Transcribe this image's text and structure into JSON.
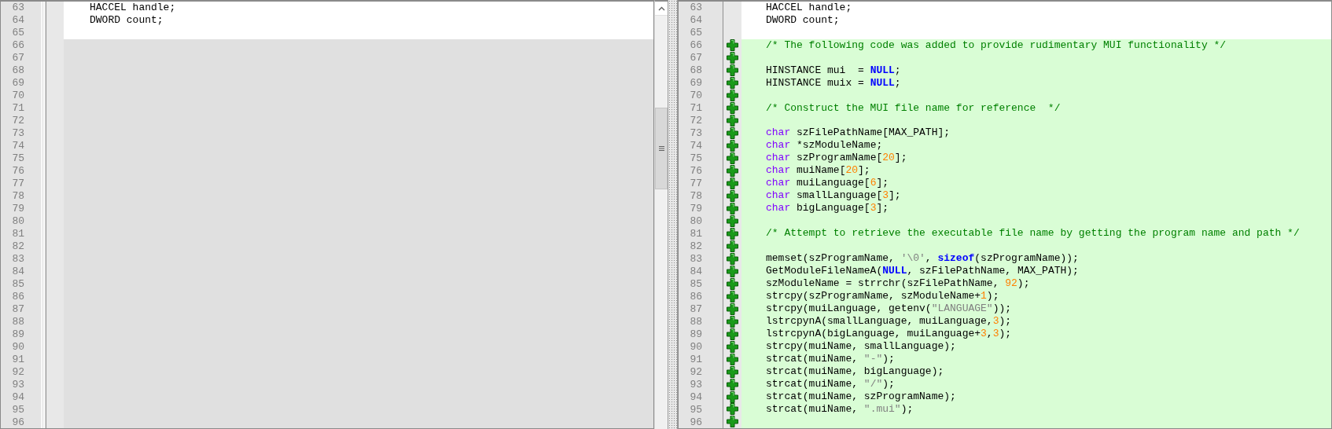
{
  "left_pane": {
    "lines": [
      {
        "number": "63",
        "kind": "normal",
        "tokens": [
          {
            "text": "HACCEL handle;",
            "kind": "plain"
          }
        ]
      },
      {
        "number": "64",
        "kind": "normal",
        "tokens": [
          {
            "text": "DWORD count;",
            "kind": "plain"
          }
        ]
      },
      {
        "number": "65",
        "kind": "normal"
      },
      {
        "number": "66",
        "kind": "placeholder"
      },
      {
        "number": "67",
        "kind": "placeholder"
      },
      {
        "number": "68",
        "kind": "placeholder"
      },
      {
        "number": "69",
        "kind": "placeholder"
      },
      {
        "number": "70",
        "kind": "placeholder"
      },
      {
        "number": "71",
        "kind": "placeholder"
      },
      {
        "number": "72",
        "kind": "placeholder"
      },
      {
        "number": "73",
        "kind": "placeholder"
      },
      {
        "number": "74",
        "kind": "placeholder"
      },
      {
        "number": "75",
        "kind": "placeholder"
      },
      {
        "number": "76",
        "kind": "placeholder"
      },
      {
        "number": "77",
        "kind": "placeholder"
      },
      {
        "number": "78",
        "kind": "placeholder"
      },
      {
        "number": "79",
        "kind": "placeholder"
      },
      {
        "number": "80",
        "kind": "placeholder"
      },
      {
        "number": "81",
        "kind": "placeholder"
      },
      {
        "number": "82",
        "kind": "placeholder"
      },
      {
        "number": "83",
        "kind": "placeholder"
      },
      {
        "number": "84",
        "kind": "placeholder"
      },
      {
        "number": "85",
        "kind": "placeholder"
      },
      {
        "number": "86",
        "kind": "placeholder"
      },
      {
        "number": "87",
        "kind": "placeholder"
      },
      {
        "number": "88",
        "kind": "placeholder"
      },
      {
        "number": "89",
        "kind": "placeholder"
      },
      {
        "number": "90",
        "kind": "placeholder"
      },
      {
        "number": "91",
        "kind": "placeholder"
      },
      {
        "number": "92",
        "kind": "placeholder"
      },
      {
        "number": "93",
        "kind": "placeholder"
      },
      {
        "number": "94",
        "kind": "placeholder"
      },
      {
        "number": "95",
        "kind": "placeholder"
      },
      {
        "number": "96",
        "kind": "placeholder"
      }
    ]
  },
  "right_pane": {
    "lines": [
      {
        "number": "63",
        "kind": "normal",
        "tokens": [
          {
            "text": "HACCEL handle;",
            "kind": "plain"
          }
        ]
      },
      {
        "number": "64",
        "kind": "normal",
        "tokens": [
          {
            "text": "DWORD count;",
            "kind": "plain"
          }
        ]
      },
      {
        "number": "65",
        "kind": "normal"
      },
      {
        "number": "66",
        "kind": "added",
        "tokens": [
          {
            "text": "/* The following code was added to provide rudimentary MUI functionality */",
            "kind": "comment"
          }
        ]
      },
      {
        "number": "67",
        "kind": "added"
      },
      {
        "number": "68",
        "kind": "added",
        "tokens": [
          {
            "text": "HINSTANCE mui  = ",
            "kind": "plain"
          },
          {
            "text": "NULL",
            "kind": "keyword"
          },
          {
            "text": ";",
            "kind": "plain"
          }
        ]
      },
      {
        "number": "69",
        "kind": "added",
        "tokens": [
          {
            "text": "HINSTANCE muix = ",
            "kind": "plain"
          },
          {
            "text": "NULL",
            "kind": "keyword"
          },
          {
            "text": ";",
            "kind": "plain"
          }
        ]
      },
      {
        "number": "70",
        "kind": "added"
      },
      {
        "number": "71",
        "kind": "added",
        "tokens": [
          {
            "text": "/* Construct the MUI file name for reference  */",
            "kind": "comment"
          }
        ]
      },
      {
        "number": "72",
        "kind": "added"
      },
      {
        "number": "73",
        "kind": "added",
        "tokens": [
          {
            "text": "char",
            "kind": "type"
          },
          {
            "text": " szFilePathName[MAX_PATH];",
            "kind": "plain"
          }
        ]
      },
      {
        "number": "74",
        "kind": "added",
        "tokens": [
          {
            "text": "char",
            "kind": "type"
          },
          {
            "text": " *szModuleName;",
            "kind": "plain"
          }
        ]
      },
      {
        "number": "75",
        "kind": "added",
        "tokens": [
          {
            "text": "char",
            "kind": "type"
          },
          {
            "text": " szProgramName[",
            "kind": "plain"
          },
          {
            "text": "20",
            "kind": "number"
          },
          {
            "text": "];",
            "kind": "plain"
          }
        ]
      },
      {
        "number": "76",
        "kind": "added",
        "tokens": [
          {
            "text": "char",
            "kind": "type"
          },
          {
            "text": " muiName[",
            "kind": "plain"
          },
          {
            "text": "20",
            "kind": "number"
          },
          {
            "text": "];",
            "kind": "plain"
          }
        ]
      },
      {
        "number": "77",
        "kind": "added",
        "tokens": [
          {
            "text": "char",
            "kind": "type"
          },
          {
            "text": " muiLanguage[",
            "kind": "plain"
          },
          {
            "text": "6",
            "kind": "number"
          },
          {
            "text": "];",
            "kind": "plain"
          }
        ]
      },
      {
        "number": "78",
        "kind": "added",
        "tokens": [
          {
            "text": "char",
            "kind": "type"
          },
          {
            "text": " smallLanguage[",
            "kind": "plain"
          },
          {
            "text": "3",
            "kind": "number"
          },
          {
            "text": "];",
            "kind": "plain"
          }
        ]
      },
      {
        "number": "79",
        "kind": "added",
        "tokens": [
          {
            "text": "char",
            "kind": "type"
          },
          {
            "text": " bigLanguage[",
            "kind": "plain"
          },
          {
            "text": "3",
            "kind": "number"
          },
          {
            "text": "];",
            "kind": "plain"
          }
        ]
      },
      {
        "number": "80",
        "kind": "added"
      },
      {
        "number": "81",
        "kind": "added",
        "tokens": [
          {
            "text": "/* Attempt to retrieve the executable file name by getting the program name and path */",
            "kind": "comment"
          }
        ]
      },
      {
        "number": "82",
        "kind": "added"
      },
      {
        "number": "83",
        "kind": "added",
        "tokens": [
          {
            "text": "memset(szProgramName, ",
            "kind": "plain"
          },
          {
            "text": "'\\0'",
            "kind": "string"
          },
          {
            "text": ", ",
            "kind": "plain"
          },
          {
            "text": "sizeof",
            "kind": "keyword"
          },
          {
            "text": "(szProgramName));",
            "kind": "plain"
          }
        ]
      },
      {
        "number": "84",
        "kind": "added",
        "tokens": [
          {
            "text": "GetModuleFileNameA(",
            "kind": "plain"
          },
          {
            "text": "NULL",
            "kind": "keyword"
          },
          {
            "text": ", szFilePathName, MAX_PATH);",
            "kind": "plain"
          }
        ]
      },
      {
        "number": "85",
        "kind": "added",
        "tokens": [
          {
            "text": "szModuleName = strrchr(szFilePathName, ",
            "kind": "plain"
          },
          {
            "text": "92",
            "kind": "number"
          },
          {
            "text": ");",
            "kind": "plain"
          }
        ]
      },
      {
        "number": "86",
        "kind": "added",
        "tokens": [
          {
            "text": "strcpy(szProgramName, szModuleName+",
            "kind": "plain"
          },
          {
            "text": "1",
            "kind": "number"
          },
          {
            "text": ");",
            "kind": "plain"
          }
        ]
      },
      {
        "number": "87",
        "kind": "added",
        "tokens": [
          {
            "text": "strcpy(muiLanguage, getenv(",
            "kind": "plain"
          },
          {
            "text": "\"LANGUAGE\"",
            "kind": "string"
          },
          {
            "text": "));",
            "kind": "plain"
          }
        ]
      },
      {
        "number": "88",
        "kind": "added",
        "tokens": [
          {
            "text": "lstrcpynA(smallLanguage, muiLanguage,",
            "kind": "plain"
          },
          {
            "text": "3",
            "kind": "number"
          },
          {
            "text": ");",
            "kind": "plain"
          }
        ]
      },
      {
        "number": "89",
        "kind": "added",
        "tokens": [
          {
            "text": "lstrcpynA(bigLanguage, muiLanguage+",
            "kind": "plain"
          },
          {
            "text": "3",
            "kind": "number"
          },
          {
            "text": ",",
            "kind": "plain"
          },
          {
            "text": "3",
            "kind": "number"
          },
          {
            "text": ");",
            "kind": "plain"
          }
        ]
      },
      {
        "number": "90",
        "kind": "added",
        "tokens": [
          {
            "text": "strcpy(muiName, smallLanguage);",
            "kind": "plain"
          }
        ]
      },
      {
        "number": "91",
        "kind": "added",
        "tokens": [
          {
            "text": "strcat(muiName, ",
            "kind": "plain"
          },
          {
            "text": "\"-\"",
            "kind": "string"
          },
          {
            "text": ");",
            "kind": "plain"
          }
        ]
      },
      {
        "number": "92",
        "kind": "added",
        "tokens": [
          {
            "text": "strcat(muiName, bigLanguage);",
            "kind": "plain"
          }
        ]
      },
      {
        "number": "93",
        "kind": "added",
        "tokens": [
          {
            "text": "strcat(muiName, ",
            "kind": "plain"
          },
          {
            "text": "\"/\"",
            "kind": "string"
          },
          {
            "text": ");",
            "kind": "plain"
          }
        ]
      },
      {
        "number": "94",
        "kind": "added",
        "tokens": [
          {
            "text": "strcat(muiName, szProgramName);",
            "kind": "plain"
          }
        ]
      },
      {
        "number": "95",
        "kind": "added",
        "tokens": [
          {
            "text": "strcat(muiName, ",
            "kind": "plain"
          },
          {
            "text": "\".mui\"",
            "kind": "string"
          },
          {
            "text": ");",
            "kind": "plain"
          }
        ]
      },
      {
        "number": "96",
        "kind": "added"
      }
    ]
  }
}
